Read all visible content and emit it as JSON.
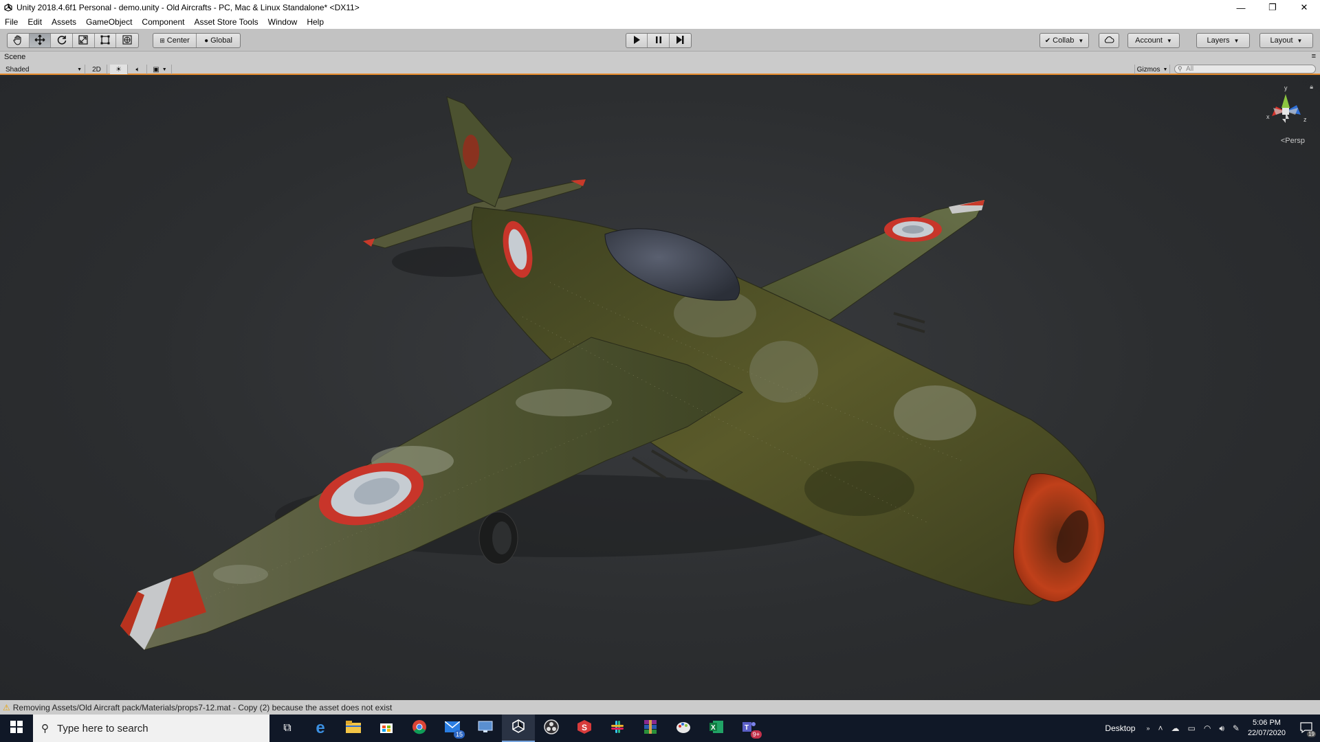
{
  "window": {
    "title": "Unity 2018.4.6f1 Personal - demo.unity - Old Aircrafts - PC, Mac & Linux Standalone* <DX11>",
    "minimize": "—",
    "restore": "❐",
    "close": "✕"
  },
  "menu": [
    "File",
    "Edit",
    "Assets",
    "GameObject",
    "Component",
    "Asset Store Tools",
    "Window",
    "Help"
  ],
  "toolbar": {
    "pivot_label": "Center",
    "space_label": "Global",
    "collab_label": "Collab",
    "account_label": "Account",
    "layers_label": "Layers",
    "layout_label": "Layout"
  },
  "scene": {
    "tab_label": "Scene",
    "shading_mode": "Shaded",
    "mode_2d": "2D",
    "gizmos_label": "Gizmos",
    "search_placeholder": "All",
    "persp_label": "Persp",
    "gizmo_axes": {
      "y": "y",
      "x": "x",
      "z": "z"
    }
  },
  "status": {
    "message": "Removing Assets/Old Aircraft pack/Materials/props7-12.mat - Copy (2) because the asset does not exist"
  },
  "taskbar": {
    "search_placeholder": "Type here to search",
    "apps": [
      {
        "name": "task-view-icon",
        "glyph": "⧉",
        "badge": ""
      },
      {
        "name": "edge-icon",
        "glyph": "e",
        "badge": ""
      },
      {
        "name": "file-explorer-icon",
        "glyph": "▬",
        "badge": ""
      },
      {
        "name": "store-icon",
        "glyph": "▦",
        "badge": ""
      },
      {
        "name": "chrome-icon",
        "glyph": "◉",
        "badge": ""
      },
      {
        "name": "mail-icon",
        "glyph": "✉",
        "badge": "15"
      },
      {
        "name": "remote-desktop-icon",
        "glyph": "▭",
        "badge": ""
      },
      {
        "name": "unity-icon",
        "glyph": "◆",
        "badge": ""
      },
      {
        "name": "obs-icon",
        "glyph": "◎",
        "badge": ""
      },
      {
        "name": "app-s-icon",
        "glyph": "S",
        "badge": ""
      },
      {
        "name": "slack-icon",
        "glyph": "#",
        "badge": ""
      },
      {
        "name": "winrar-icon",
        "glyph": "▤",
        "badge": ""
      },
      {
        "name": "paint-icon",
        "glyph": "✎",
        "badge": ""
      },
      {
        "name": "excel-icon",
        "glyph": "X",
        "badge": ""
      },
      {
        "name": "teams-icon",
        "glyph": "T",
        "badge": "9+"
      }
    ],
    "desktop_label": "Desktop",
    "time": "5:06 PM",
    "date": "22/07/2020",
    "notification_count": "19"
  },
  "colors": {
    "accent_orange": "#e88c2c",
    "toolbar_bg": "#c2c2c2",
    "viewport_bg": "#2c2e30",
    "taskbar_bg": "#101827"
  }
}
